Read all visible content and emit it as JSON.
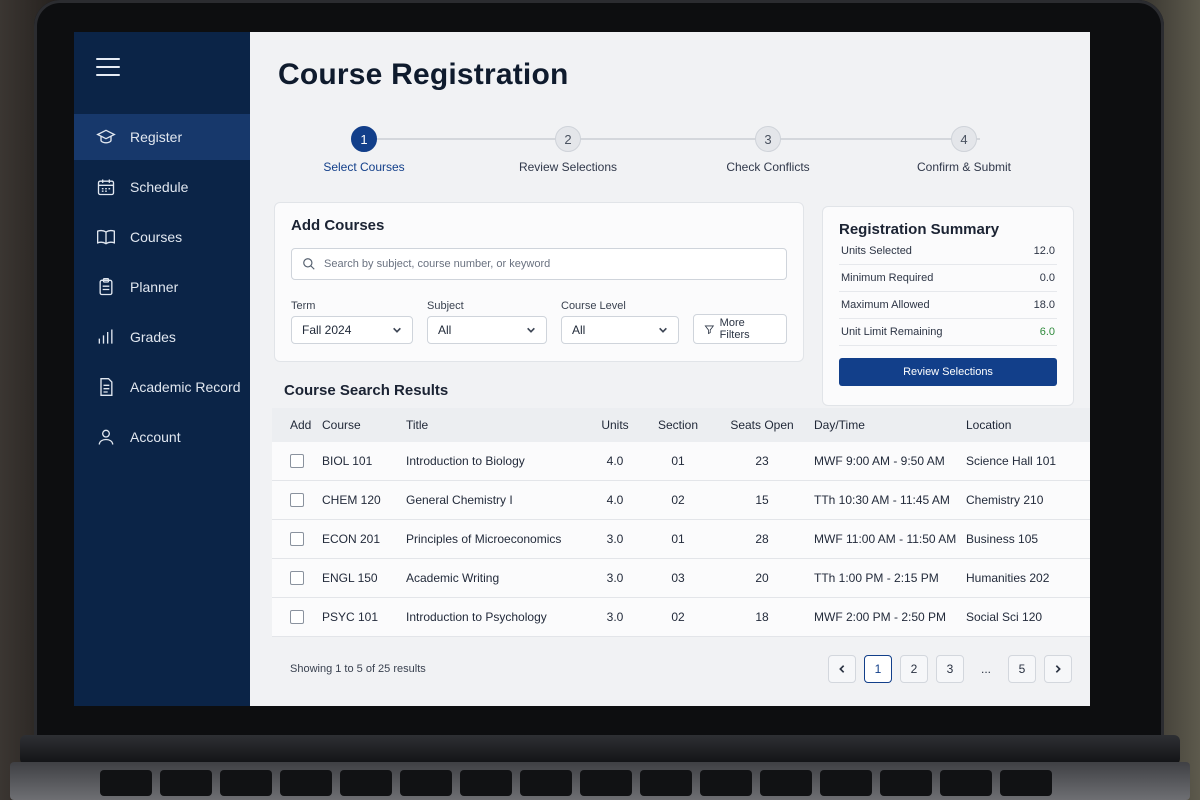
{
  "page": {
    "title": "Course Registration"
  },
  "sidebar": {
    "items": [
      {
        "label": "Register",
        "icon": "graduation-cap-icon",
        "active": true
      },
      {
        "label": "Schedule",
        "icon": "calendar-icon"
      },
      {
        "label": "Courses",
        "icon": "book-icon"
      },
      {
        "label": "Planner",
        "icon": "clipboard-icon"
      },
      {
        "label": "Grades",
        "icon": "bar-chart-icon"
      },
      {
        "label": "Academic Record",
        "icon": "document-icon"
      },
      {
        "label": "Account",
        "icon": "user-icon"
      }
    ]
  },
  "stepper": {
    "steps": [
      {
        "num": "1",
        "label": "Select Courses"
      },
      {
        "num": "2",
        "label": "Review Selections"
      },
      {
        "num": "3",
        "label": "Check Conflicts"
      },
      {
        "num": "4",
        "label": "Confirm & Submit"
      }
    ]
  },
  "add_courses": {
    "title": "Add Courses",
    "search_placeholder": "Search by subject, course number, or keyword",
    "term_label": "Term",
    "term_value": "Fall 2024",
    "subject_label": "Subject",
    "subject_value": "All",
    "level_label": "Course Level",
    "level_value": "All",
    "more_filters": "More Filters"
  },
  "summary": {
    "title": "Registration Summary",
    "rows": [
      {
        "label": "Units Selected",
        "value": "12.0"
      },
      {
        "label": "Minimum Required",
        "value": "0.0"
      },
      {
        "label": "Maximum Allowed",
        "value": "18.0"
      },
      {
        "label": "Unit Limit Remaining",
        "value": "6.0"
      }
    ],
    "button": "Review Selections"
  },
  "results": {
    "title": "Course Search Results",
    "headers": {
      "add": "Add",
      "course": "Course",
      "title": "Title",
      "units": "Units",
      "section": "Section",
      "seats": "Seats Open",
      "day": "Day/Time",
      "location": "Location"
    },
    "rows": [
      {
        "course": "BIOL 101",
        "title": "Introduction to Biology",
        "units": "4.0",
        "section": "01",
        "seats": "23",
        "day": "MWF 9:00 AM - 9:50 AM",
        "location": "Science Hall 101"
      },
      {
        "course": "CHEM 120",
        "title": "General Chemistry I",
        "units": "4.0",
        "section": "02",
        "seats": "15",
        "day": "TTh 10:30 AM - 11:45 AM",
        "location": "Chemistry 210"
      },
      {
        "course": "ECON 201",
        "title": "Principles of Microeconomics",
        "units": "3.0",
        "section": "01",
        "seats": "28",
        "day": "MWF 11:00 AM - 11:50 AM",
        "location": "Business 105"
      },
      {
        "course": "ENGL 150",
        "title": "Academic Writing",
        "units": "3.0",
        "section": "03",
        "seats": "20",
        "day": "TTh 1:00 PM - 2:15 PM",
        "location": "Humanities 202"
      },
      {
        "course": "PSYC 101",
        "title": "Introduction to Psychology",
        "units": "3.0",
        "section": "02",
        "seats": "18",
        "day": "MWF 2:00 PM - 2:50 PM",
        "location": "Social Sci 120"
      }
    ],
    "showing": "Showing 1 to 5 of 25 results",
    "pages": [
      "1",
      "2",
      "3",
      "...",
      "5"
    ]
  },
  "colors": {
    "sidebar": "#0b2447",
    "accent": "#123f8a",
    "positive": "#2f8a3c"
  }
}
